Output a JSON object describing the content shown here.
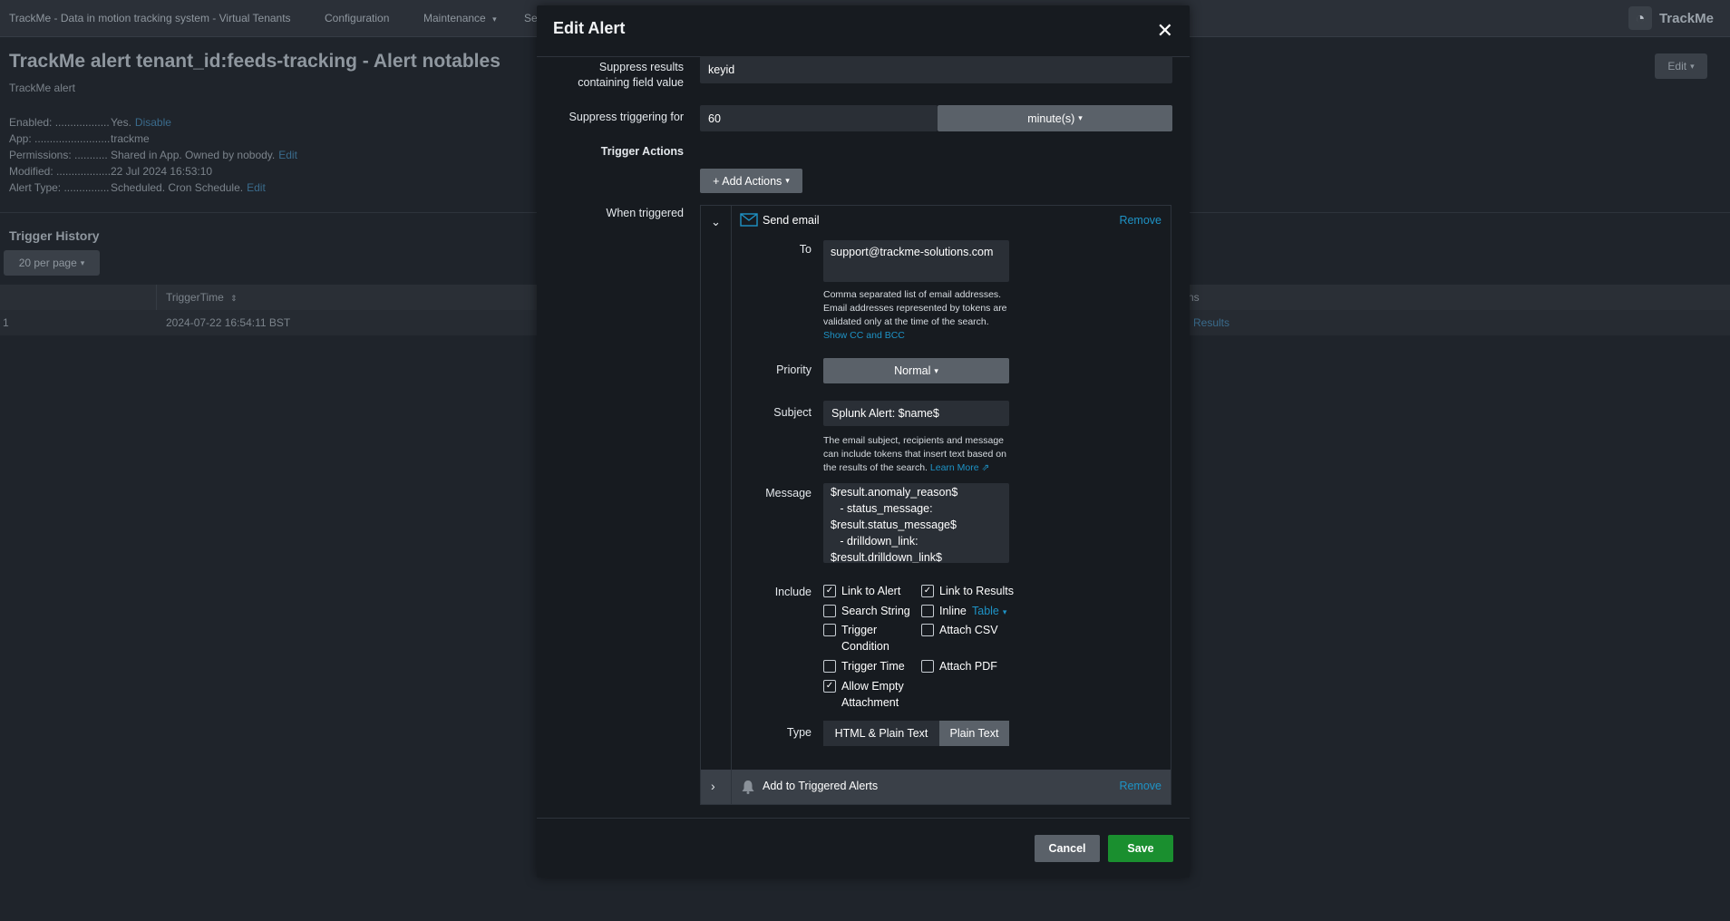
{
  "topnav": {
    "items": [
      "TrackMe - Data in motion tracking system - Virtual Tenants",
      "Configuration",
      "Maintenance",
      "Se"
    ],
    "brand": "TrackMe"
  },
  "page": {
    "title": "TrackMe alert tenant_id:feeds-tracking - Alert notables",
    "subtitle": "TrackMe alert",
    "edit_label": "Edit",
    "meta": [
      {
        "key": "Enabled: ..................",
        "value": "Yes.",
        "link": "Disable"
      },
      {
        "key": "App: .........................",
        "value": "trackme",
        "link": ""
      },
      {
        "key": "Permissions: ...........",
        "value": "Shared in App. Owned by nobody.",
        "link": "Edit"
      },
      {
        "key": "Modified: ..................",
        "value": "22 Jul 2024 16:53:10",
        "link": ""
      },
      {
        "key": "Alert Type: ...............",
        "value": "Scheduled. Cron Schedule.",
        "link": "Edit"
      }
    ],
    "history_title": "Trigger History",
    "per_page": "20 per page",
    "table": {
      "col_trigger": "TriggerTime",
      "col_actions_partial": "ns",
      "row_index": "1",
      "row_time": "2024-07-22 16:54:11 BST",
      "row_link_partial": "Results"
    }
  },
  "modal": {
    "title": "Edit Alert",
    "suppress_field_label": "Suppress results containing field value",
    "suppress_field_value": "keyid",
    "suppress_for_label": "Suppress triggering for",
    "suppress_for_value": "60",
    "suppress_unit": "minute(s)",
    "trigger_actions_label": "Trigger Actions",
    "add_actions": "+ Add Actions",
    "when_triggered_label": "When triggered",
    "email": {
      "title": "Send email",
      "remove": "Remove",
      "to_label": "To",
      "to_value": "support@trackme-solutions.com",
      "to_help": "Comma separated list of email addresses. Email addresses represented by tokens are validated only at the time of the search.",
      "show_cc": "Show CC and BCC",
      "priority_label": "Priority",
      "priority_value": "Normal",
      "subject_label": "Subject",
      "subject_value": "Splunk Alert: $name$",
      "subject_help": "The email subject, recipients and message can include tokens that insert text based on the results of the search.",
      "learn_more": "Learn More",
      "message_label": "Message",
      "message_lines": [
        "$result.anomaly_reason$",
        "   - status_message:",
        "$result.status_message$",
        "   - drilldown_link:",
        "$result.drilldown_link$"
      ],
      "include_label": "Include",
      "include": {
        "link_alert": "Link to Alert",
        "link_results": "Link to Results",
        "search_string": "Search String",
        "inline": "Inline",
        "inline_format": "Table",
        "trigger_condition": "Trigger Condition",
        "attach_csv": "Attach CSV",
        "trigger_time": "Trigger Time",
        "attach_pdf": "Attach PDF",
        "allow_empty": "Allow Empty Attachment"
      },
      "type_label": "Type",
      "type_html": "HTML & Plain Text",
      "type_plain": "Plain Text"
    },
    "triggered_alerts": {
      "title": "Add to Triggered Alerts",
      "remove": "Remove"
    },
    "cancel": "Cancel",
    "save": "Save"
  },
  "colors": {
    "accent_link": "#1e93c6",
    "save_green": "#1a8f2f",
    "modal_bg": "#171b20"
  }
}
